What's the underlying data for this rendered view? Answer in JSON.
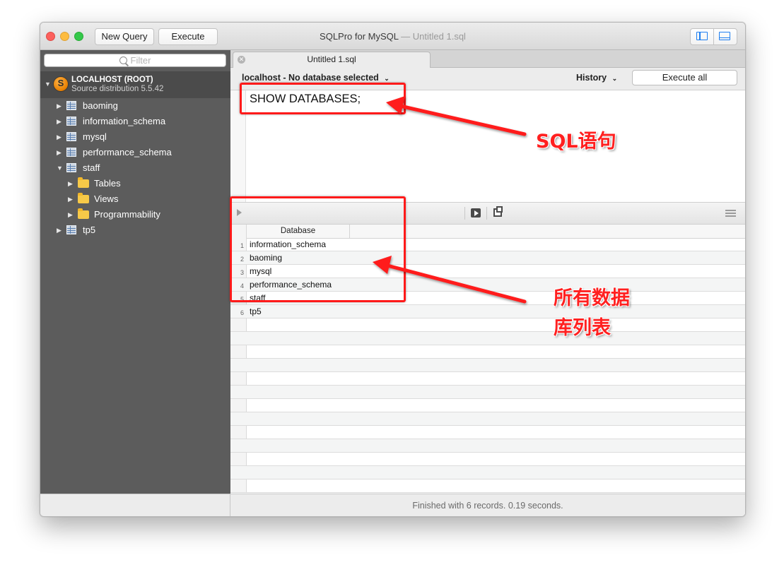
{
  "window": {
    "title": "SQLPro for MySQL",
    "title_file": "— Untitled 1.sql"
  },
  "toolbar": {
    "new_query_label": "New Query",
    "execute_label": "Execute"
  },
  "sidebar": {
    "filter_placeholder": "Filter",
    "connection": {
      "name": "LOCALHOST (ROOT)",
      "subtitle": "Source distribution 5.5.42"
    },
    "databases": [
      {
        "label": "baoming",
        "expanded": false
      },
      {
        "label": "information_schema",
        "expanded": false
      },
      {
        "label": "mysql",
        "expanded": false
      },
      {
        "label": "performance_schema",
        "expanded": false
      },
      {
        "label": "staff",
        "expanded": true
      },
      {
        "label": "tp5",
        "expanded": false
      }
    ],
    "staff_children": [
      {
        "label": "Tables"
      },
      {
        "label": "Views"
      },
      {
        "label": "Programmability"
      }
    ]
  },
  "editor": {
    "tab_label": "Untitled 1.sql",
    "database_selector": "localhost - No database selected",
    "history_label": "History",
    "execute_all_label": "Execute all",
    "sql_text": "SHOW DATABASES;"
  },
  "results": {
    "column_header": "Database",
    "rows": [
      {
        "num": "1",
        "value": "information_schema"
      },
      {
        "num": "2",
        "value": "baoming"
      },
      {
        "num": "3",
        "value": "mysql"
      },
      {
        "num": "4",
        "value": "performance_schema"
      },
      {
        "num": "5",
        "value": "staff"
      },
      {
        "num": "6",
        "value": "tp5"
      }
    ],
    "status_text": "Finished with 6 records. 0.19 seconds."
  },
  "annotations": {
    "sql_label": "SQL语句",
    "list_label_line1": "所有数据",
    "list_label_line2": "库列表",
    "color": "#ff1a1a"
  }
}
